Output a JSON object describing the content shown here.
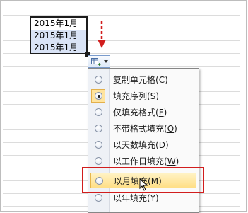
{
  "cells": [
    "2015年1月",
    "2015年1月",
    "2015年1月"
  ],
  "autofill_button": {
    "icon": "autofill-options-icon"
  },
  "menu": {
    "items": [
      {
        "label": "复制单元格",
        "key": "C",
        "selected": false
      },
      {
        "label": "填充序列",
        "key": "S",
        "selected": true
      },
      {
        "label": "仅填充格式",
        "key": "F",
        "selected": false
      },
      {
        "label": "不带格式填充",
        "key": "O",
        "selected": false
      },
      {
        "label": "以天数填充",
        "key": "D",
        "selected": false
      },
      {
        "label": "以工作日填充",
        "key": "W",
        "selected": false
      },
      {
        "label": "以月填充",
        "key": "M",
        "selected": false,
        "highlighted": true
      },
      {
        "label": "以年填充",
        "key": "Y",
        "selected": false
      }
    ]
  },
  "colors": {
    "annotation_red": "#d11d1d",
    "highlight": "#ffdf86",
    "selection": "#d9e3f6"
  }
}
